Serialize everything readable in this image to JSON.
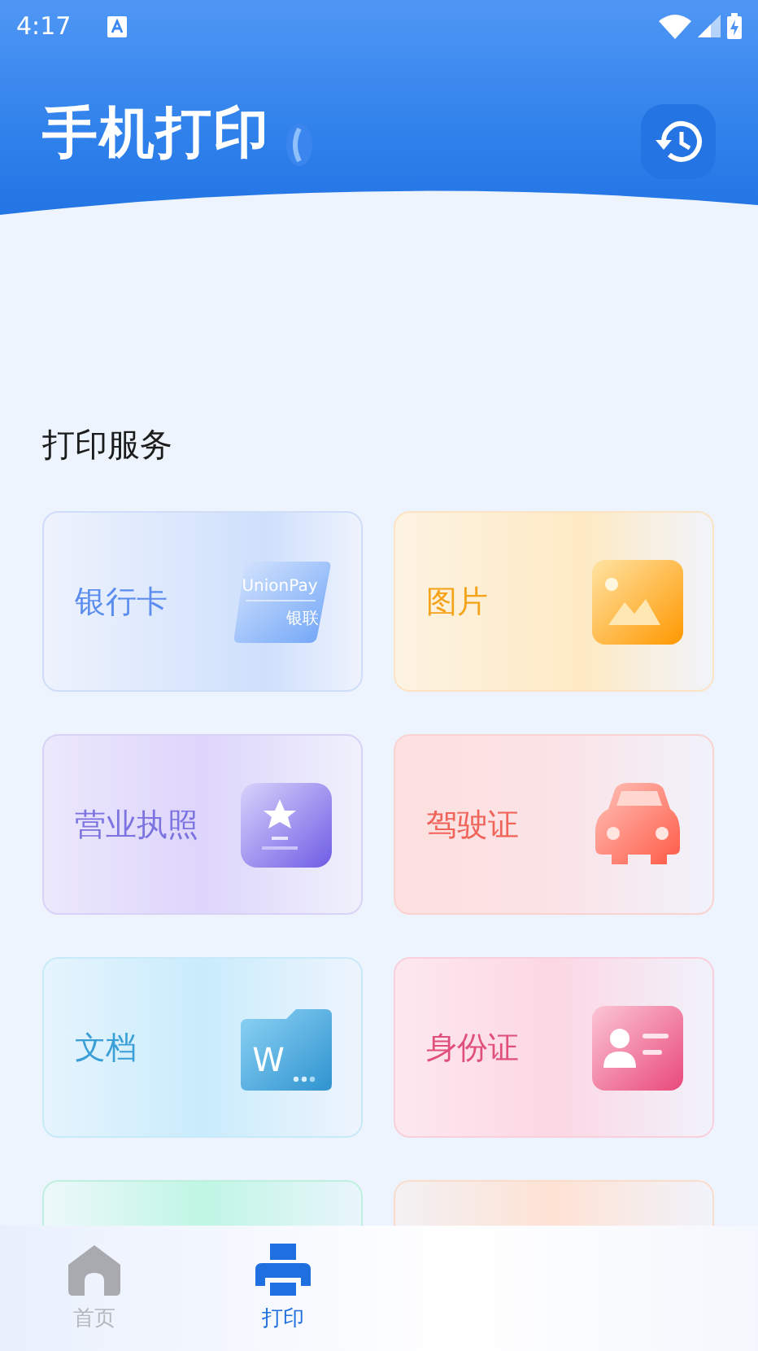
{
  "status_bar": {
    "time": "4:17"
  },
  "header": {
    "title": "手机打印"
  },
  "section": {
    "title": "打印服务"
  },
  "services": [
    {
      "label": "银行卡",
      "kind": "bank",
      "color": "#5b8def",
      "icon_text": [
        "UnionPay",
        "银联"
      ]
    },
    {
      "label": "图片",
      "kind": "image",
      "color": "#f5a31a"
    },
    {
      "label": "营业执照",
      "kind": "license",
      "color": "#7b74e0"
    },
    {
      "label": "驾驶证",
      "kind": "car",
      "color": "#f0645a"
    },
    {
      "label": "文档",
      "kind": "doc",
      "color": "#3a9fd6",
      "icon_text": [
        "W"
      ]
    },
    {
      "label": "身份证",
      "kind": "id",
      "color": "#e0507a"
    },
    {
      "kind": "green"
    },
    {
      "kind": "peach"
    }
  ],
  "nav": [
    {
      "label": "首页",
      "kind": "home",
      "selected": false
    },
    {
      "label": "打印",
      "kind": "print",
      "selected": true
    }
  ]
}
